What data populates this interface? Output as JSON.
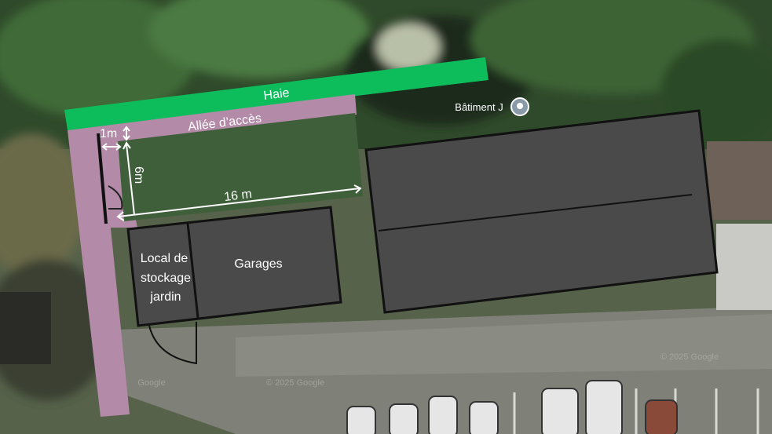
{
  "labels": {
    "hedge": "Haie",
    "access_path": "Allée d’accès",
    "building_j": "Bâtiment J",
    "dim_1m": "1m",
    "dim_6m": "6m",
    "dim_16m": "16 m",
    "storage_line1": "Local de",
    "storage_line2": "stockage",
    "storage_line3": "jardin",
    "garages": "Garages",
    "watermark_1": "© 2025 Google",
    "watermark_2": "© 2025 Google",
    "watermark_3": "Google"
  },
  "colors": {
    "hedge": "#0dbd5c",
    "path": "#b38aa7",
    "garden": "#3f5f3a",
    "building": "#4a4a4a",
    "outline": "#111111",
    "label_text": "#ffffff"
  },
  "icons": {
    "building_marker": "map-pin-icon"
  }
}
